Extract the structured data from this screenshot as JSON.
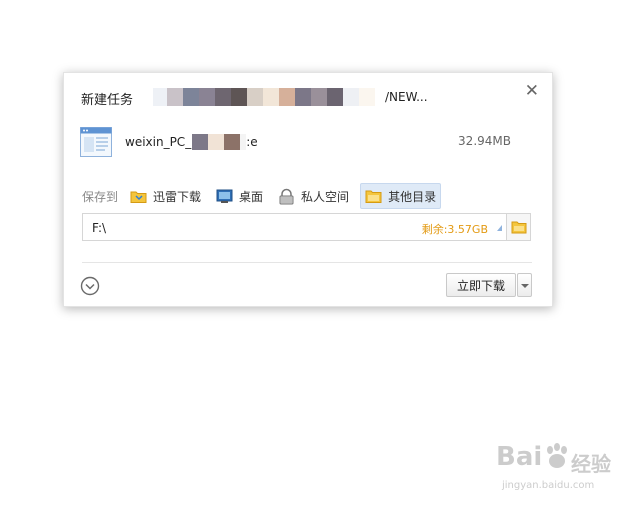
{
  "dialog": {
    "title": "新建任务",
    "url_suffix": "/NEW...",
    "close_glyph": "✕",
    "icons": {
      "close": "close-icon",
      "file": "document-icon",
      "browse": "folder-icon",
      "expand": "chevron-down-circle-icon"
    }
  },
  "file": {
    "name_prefix": "weixin_PC_",
    "name_suffix": ":e",
    "size": "32.94MB"
  },
  "save": {
    "label": "保存到",
    "locations": [
      {
        "label": "迅雷下载",
        "icon": "folder-download-icon"
      },
      {
        "label": "桌面",
        "icon": "desktop-icon"
      },
      {
        "label": "私人空间",
        "icon": "private-space-icon"
      },
      {
        "label": "其他目录",
        "icon": "folder-icon",
        "selected": true
      }
    ]
  },
  "path": {
    "value": "F:\\",
    "free_space": "剩余:3.57GB"
  },
  "actions": {
    "download_now": "立即下载"
  },
  "watermark": {
    "brand": "Bai",
    "brand2": "经验",
    "url": "jingyan.baidu.com"
  },
  "colors": {
    "free_space": "#e39a13",
    "selected_bg": "#dfeaf7",
    "folder": "#f4c53d"
  }
}
